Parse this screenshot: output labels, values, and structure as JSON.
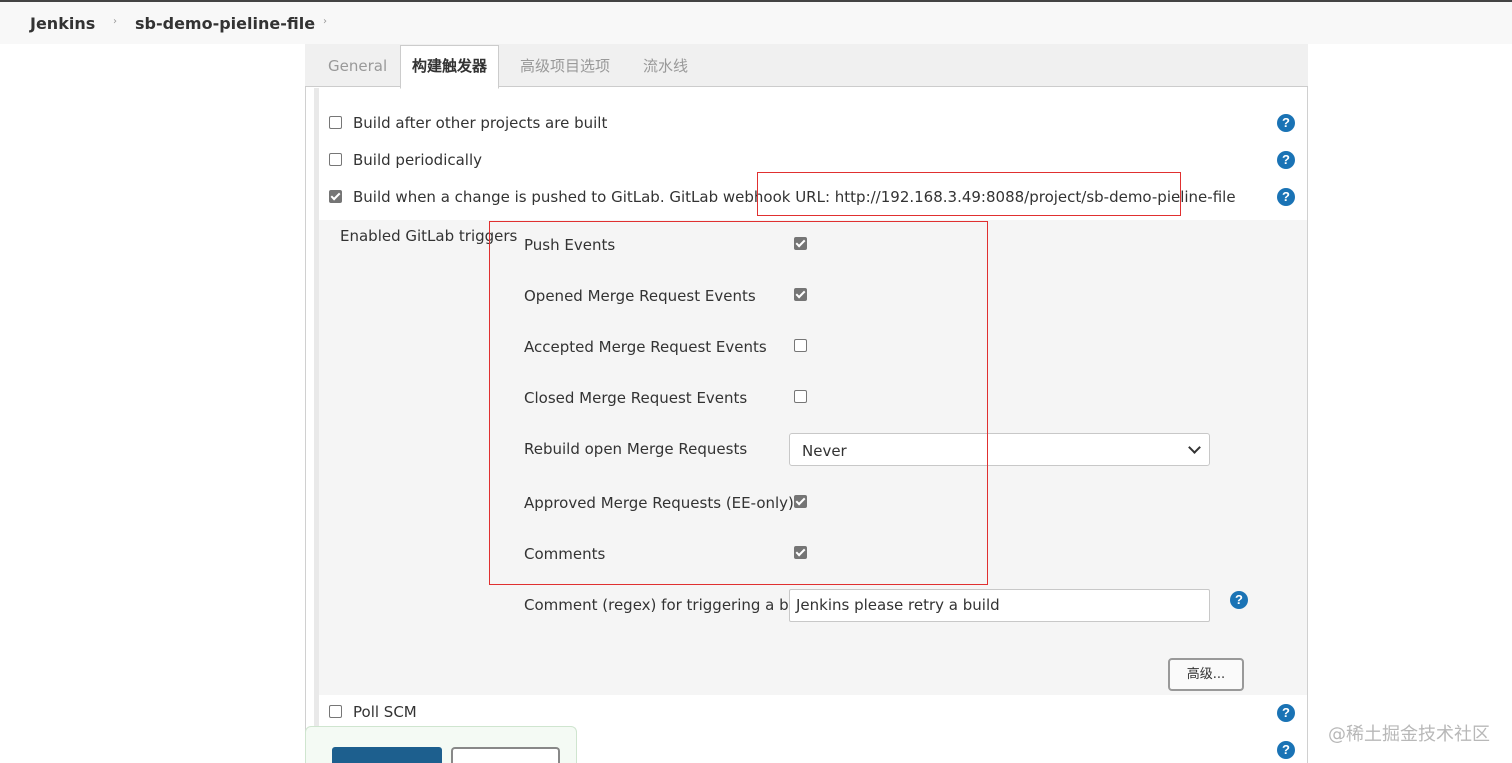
{
  "breadcrumb": {
    "items": [
      {
        "label": "Jenkins"
      },
      {
        "label": "sb-demo-pieline-file"
      }
    ],
    "separator": "›"
  },
  "tabs": [
    {
      "label": "General",
      "active": false
    },
    {
      "label": "构建触发器",
      "active": true
    },
    {
      "label": "高级项目选项",
      "active": false
    },
    {
      "label": "流水线",
      "active": false
    }
  ],
  "triggers": {
    "build_after": {
      "label": "Build after other projects are built",
      "checked": false
    },
    "build_periodically": {
      "label": "Build periodically",
      "checked": false
    },
    "gitlab_push": {
      "label": "Build when a change is pushed to GitLab. GitLab webhook URL: http://192.168.3.49:8088/project/sb-demo-pieline-file",
      "checked": true
    },
    "poll_scm": {
      "label": "Poll SCM",
      "checked": false
    }
  },
  "gitlab": {
    "section_label": "Enabled GitLab triggers",
    "push_events": {
      "label": "Push Events",
      "checked": true
    },
    "opened_mr": {
      "label": "Opened Merge Request Events",
      "checked": true
    },
    "accepted_mr": {
      "label": "Accepted Merge Request Events",
      "checked": false
    },
    "closed_mr": {
      "label": "Closed Merge Request Events",
      "checked": false
    },
    "rebuild_open_mr": {
      "label": "Rebuild open Merge Requests",
      "value": "Never"
    },
    "approved_mr": {
      "label": "Approved Merge Requests (EE-only)",
      "checked": true
    },
    "comments": {
      "label": "Comments",
      "checked": true
    },
    "comment_regex": {
      "label": "Comment (regex) for triggering a build",
      "value": "Jenkins please retry a build"
    },
    "advanced_button": "高级..."
  },
  "help_icon": {
    "glyph": "?",
    "color": "#1a73b5"
  },
  "watermark": "@稀土掘金技术社区",
  "colors": {
    "highlight_border": "#e03030",
    "save_button": "#1d5f8e"
  }
}
